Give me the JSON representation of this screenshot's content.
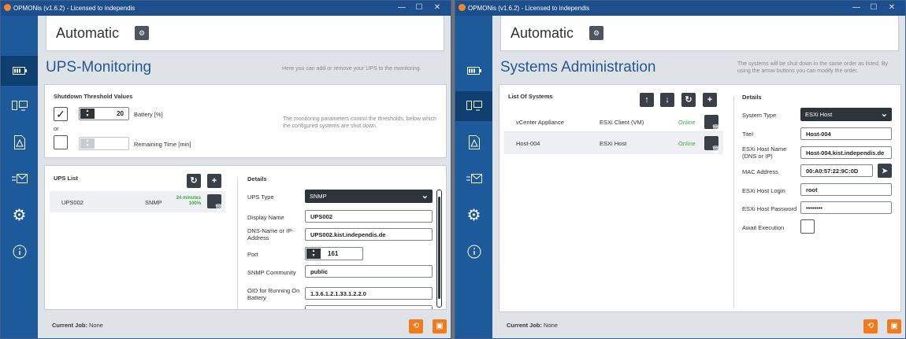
{
  "app": {
    "title": "OPMONis (v1.6.2) - Licensed to independis",
    "minimize": "—",
    "maximize": "☐",
    "close": "✕"
  },
  "left": {
    "mode": "Automatic",
    "page_title": "UPS-Monitoring",
    "page_hint": "Here you can add or remove your UPS to the monitoring.",
    "thresholds": {
      "title": "Shutdown Threshold Values",
      "battery_value": "20",
      "battery_label": "Battery [%]",
      "or_label": "or",
      "remaining_value": "",
      "remaining_label": "Remaining Time [min]",
      "hint": "The monitoring parameters control the thresholds, below which the configured systems are shut down."
    },
    "ups_list": {
      "title": "UPS List",
      "rows": [
        {
          "name": "UPS002",
          "type": "SNMP",
          "time": "24 minutes",
          "pct": "100%"
        }
      ]
    },
    "details": {
      "title": "Details",
      "ups_type_label": "UPS Type",
      "ups_type_value": "SNMP",
      "display_name_label": "Display Name",
      "display_name_value": "UPS002",
      "dns_label_1": "DNS-Name or IP-",
      "dns_label_2": "Address",
      "dns_value": "UPS002.kist.independis.de",
      "port_label": "Port",
      "port_value": "161",
      "community_label": "SNMP Community",
      "community_value": "public",
      "oid_label_1": "OID for Running On",
      "oid_label_2": "Battery",
      "oid_value": "1.3.6.1.2.1.33.1.2.2.0"
    },
    "footer": {
      "job_label": "Current Job:",
      "job_value": "None"
    }
  },
  "right": {
    "mode": "Automatic",
    "page_title": "Systems Administration",
    "page_hint_1": "The systems will be shut down in the same order as listed. By",
    "page_hint_2": "using the arrow buttons you can modify the order.",
    "systems": {
      "title": "List Of Systems",
      "rows": [
        {
          "name": "vCenter Appliance",
          "type": "ESXi Client (VM)",
          "status": "Online"
        },
        {
          "name": "Host-004",
          "type": "ESXi Host",
          "status": "Online"
        }
      ]
    },
    "details": {
      "title": "Details",
      "system_type_label": "System Type",
      "system_type_value": "ESXi Host",
      "titel_label": "Titel",
      "titel_value": "Host-004",
      "host_label_1": "ESXi Host Name",
      "host_label_2": "(DNS or IP)",
      "host_value": "Host-004.kist.independis.de",
      "mac_label": "MAC Address",
      "mac_value": "00:A0:57:22:9C:0D",
      "login_label": "ESXi Host Login",
      "login_value": "root",
      "password_label": "ESXi Host Password",
      "password_value": "••••••••",
      "await_label": "Await Execution"
    },
    "footer": {
      "job_label": "Current Job:",
      "job_value": "None"
    }
  },
  "colors": {
    "accent": "#1f5a96",
    "sidebar": "#1d5a9b",
    "sidebar_active": "#0f3e70",
    "orange": "#f07b1d",
    "online": "#3fae3f"
  }
}
